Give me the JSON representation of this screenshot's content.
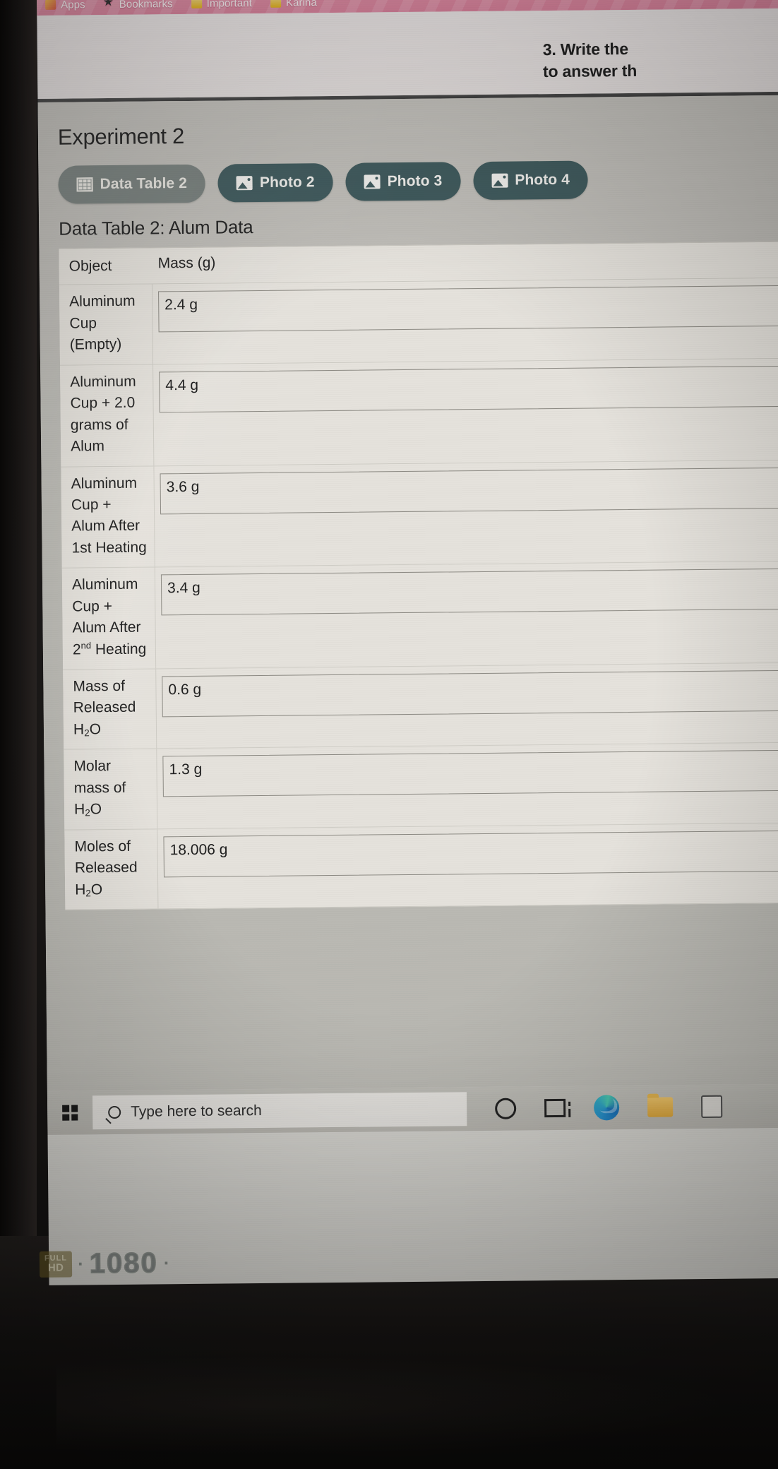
{
  "browser": {
    "bookmarks": [
      {
        "label": "Apps",
        "icon": "apps-icon"
      },
      {
        "label": "Bookmarks",
        "icon": "star-icon"
      },
      {
        "label": "Important",
        "icon": "folder-icon"
      },
      {
        "label": "Karina",
        "icon": "folder-icon"
      }
    ],
    "overflow_icon": "chevron-right-icon"
  },
  "page": {
    "question_line1": "3. Write the",
    "question_line2": "to answer th"
  },
  "experiment": {
    "title": "Experiment 2",
    "tabs": [
      {
        "label": "Data Table 2",
        "icon": "table-icon",
        "active": true
      },
      {
        "label": "Photo 2",
        "icon": "photo-icon",
        "active": false
      },
      {
        "label": "Photo 3",
        "icon": "photo-icon",
        "active": false
      },
      {
        "label": "Photo 4",
        "icon": "photo-icon",
        "active": false
      }
    ],
    "table_caption": "Data Table 2: Alum Data",
    "columns": [
      "Object",
      "Mass (g)"
    ],
    "rows": [
      {
        "object": "Aluminum Cup (Empty)",
        "value": "2.4 g"
      },
      {
        "object": "Aluminum Cup + 2.0 grams of Alum",
        "value": "4.4 g"
      },
      {
        "object": "Aluminum Cup + Alum After 1st Heating",
        "value": "3.6 g"
      },
      {
        "object": "Aluminum Cup + Alum After 2nd Heating",
        "value": "3.4 g"
      },
      {
        "object": "Mass of Released H2O",
        "value": "0.6 g"
      },
      {
        "object": "Molar mass of H2O",
        "value": "1.3 g"
      },
      {
        "object": "Moles of Released H2O",
        "value": "18.006 g"
      }
    ]
  },
  "taskbar": {
    "start_icon": "windows-start-icon",
    "search_placeholder": "Type here to search",
    "search_icon": "search-icon",
    "icons": [
      {
        "name": "cortana-icon"
      },
      {
        "name": "task-view-icon"
      },
      {
        "name": "edge-browser-icon"
      },
      {
        "name": "file-explorer-icon"
      },
      {
        "name": "microsoft-store-icon"
      }
    ]
  },
  "monitor_badge": {
    "full": "FULL",
    "hd": "HD",
    "resolution": "1080"
  },
  "colors": {
    "bookmark_bar": "#e27f9d",
    "panel_bg": "#bfbdb7",
    "tab_active": "#78817e",
    "tab_idle": "#3d5a5d",
    "table_bg": "#e9e6df",
    "taskbar": "#bfbdb7"
  }
}
